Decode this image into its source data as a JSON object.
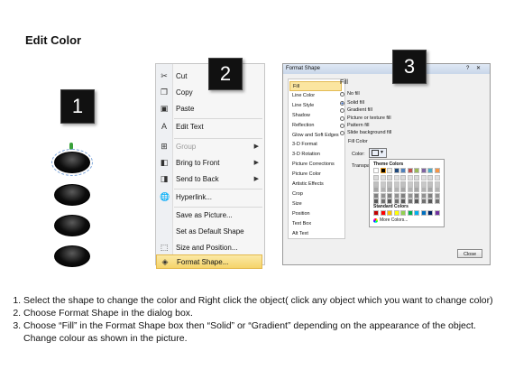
{
  "title": "Edit Color",
  "badges": [
    "1",
    "2",
    "3"
  ],
  "context_menu": {
    "items": [
      {
        "label": "Cut",
        "icon": "scissors-icon",
        "glyph": "✂",
        "submenu": false,
        "disabled": false
      },
      {
        "label": "Copy",
        "icon": "copy-icon",
        "glyph": "❐",
        "submenu": false,
        "disabled": false
      },
      {
        "label": "Paste",
        "icon": "paste-icon",
        "glyph": "▣",
        "submenu": false,
        "disabled": false
      },
      {
        "label": "Edit Text",
        "icon": "edit-text-icon",
        "glyph": "A",
        "submenu": false,
        "disabled": false
      },
      {
        "label": "Group",
        "icon": "group-icon",
        "glyph": "⊞",
        "submenu": true,
        "disabled": true
      },
      {
        "label": "Bring to Front",
        "icon": "bring-to-front-icon",
        "glyph": "◧",
        "submenu": true,
        "disabled": false
      },
      {
        "label": "Send to Back",
        "icon": "send-to-back-icon",
        "glyph": "◨",
        "submenu": true,
        "disabled": false
      },
      {
        "label": "Hyperlink...",
        "icon": "hyperlink-icon",
        "glyph": "🌐",
        "submenu": false,
        "disabled": false
      },
      {
        "label": "Save as Picture...",
        "icon": "",
        "glyph": "",
        "submenu": false,
        "disabled": false
      },
      {
        "label": "Set as Default Shape",
        "icon": "",
        "glyph": "",
        "submenu": false,
        "disabled": false
      },
      {
        "label": "Size and Position...",
        "icon": "size-position-icon",
        "glyph": "⬚",
        "submenu": false,
        "disabled": false
      },
      {
        "label": "Format Shape...",
        "icon": "format-shape-icon",
        "glyph": "◈",
        "submenu": false,
        "disabled": false,
        "highlighted": true
      }
    ]
  },
  "dialog": {
    "title": "Format Shape",
    "controls": [
      "?",
      "✕"
    ],
    "nav": [
      "Fill",
      "Line Color",
      "Line Style",
      "Shadow",
      "Reflection",
      "Glow and Soft Edges",
      "3-D Format",
      "3-D Rotation",
      "Picture Corrections",
      "Picture Color",
      "Artistic Effects",
      "Crop",
      "Size",
      "Position",
      "Text Box",
      "Alt Text"
    ],
    "selected_nav": "Fill",
    "section_title": "Fill",
    "fill_options": [
      "No fill",
      "Solid fill",
      "Gradient fill",
      "Picture or texture fill",
      "Pattern fill",
      "Slide background fill"
    ],
    "selected_fill": "Solid fill",
    "fill_color_label": "Fill Color",
    "color_label": "Color:",
    "transparency_label": "Transpa",
    "palette": {
      "theme_label": "Theme Colors",
      "standard_label": "Standard Colors",
      "more_colors": "More Colors...",
      "theme_top": [
        "#ffffff",
        "#000000",
        "#eeece1",
        "#1f497d",
        "#4f81bd",
        "#c0504d",
        "#9bbb59",
        "#8064a2",
        "#4bacc6",
        "#f79646"
      ],
      "theme_shades": [
        "#d9d9d9",
        "#bfbfbf",
        "#a6a6a6",
        "#808080",
        "#595959"
      ],
      "standard": [
        "#c00000",
        "#ff0000",
        "#ffc000",
        "#ffff00",
        "#92d050",
        "#00b050",
        "#00b0f0",
        "#0070c0",
        "#002060",
        "#7030a0"
      ]
    },
    "close_label": "Close"
  },
  "instructions": [
    "Select the shape to change the color and Right click the object( click any object which you want to change color)",
    "Choose Format Shape in the dialog box.",
    "Choose “Fill” in the Format Shape box then “Solid” or “Gradient” depending on the appearance of the object. Change colour as shown in the picture."
  ]
}
